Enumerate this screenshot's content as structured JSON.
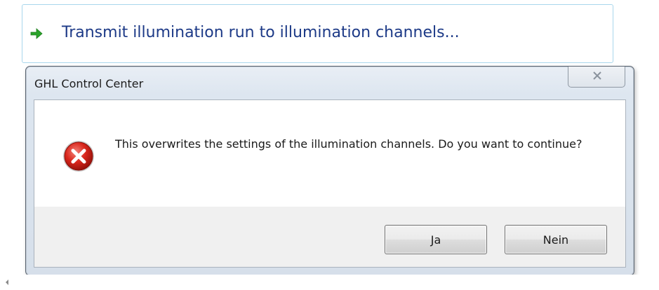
{
  "command_link": {
    "label": "Transmit illumination run to illumination channels...",
    "arrow_icon": "green-arrow-icon",
    "accent_color": "#1d3a87"
  },
  "dialog": {
    "title": "GHL Control Center",
    "close_icon": "close-icon",
    "message_icon": "error-icon",
    "message": "This overwrites the settings of the illumination channels. Do you want to continue?",
    "buttons": {
      "yes_label": "Ja",
      "no_label": "Nein"
    }
  },
  "scrollbar": {
    "left_arrow_icon": "scroll-left-icon"
  }
}
